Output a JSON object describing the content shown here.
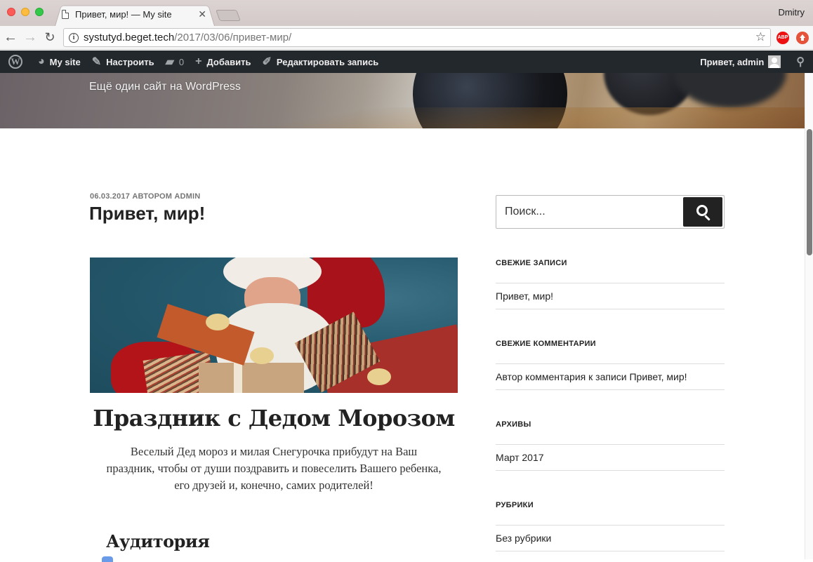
{
  "browser": {
    "tab_title": "Привет, мир! — My site",
    "profile_name": "Dmitry",
    "url_host": "systutyd.beget.tech",
    "url_path": "/2017/03/06/привет-мир/",
    "ext_abp_label": "ABP"
  },
  "admin_bar": {
    "wp_logo": "W",
    "site_name": "My site",
    "customize": "Настроить",
    "comments_count": "0",
    "add_new": "Добавить",
    "edit_post": "Редактировать запись",
    "greeting": "Привет, admin"
  },
  "header": {
    "site_description": "Ещё один сайт на WordPress"
  },
  "post": {
    "date": "06.03.2017",
    "by_label": "АВТОРОМ",
    "author": "admin",
    "title": "Привет, мир!",
    "promo_title": "Праздник с Дедом Морозом",
    "promo_text": "Веселый Дед мороз и милая Снегурочка прибудут на Ваш праздник, чтобы от души поздравить и повеселить Вашего ребенка, его друзей и, конечно, самих родителей!",
    "section_title": "Аудитория"
  },
  "sidebar": {
    "search_placeholder": "Поиск...",
    "widgets": [
      {
        "title": "СВЕЖИЕ ЗАПИСИ",
        "items": [
          "Привет, мир!"
        ]
      },
      {
        "title": "СВЕЖИЕ КОММЕНТАРИИ",
        "items": [
          "Автор комментария к записи Привет, мир!"
        ]
      },
      {
        "title": "АРХИВЫ",
        "items": [
          "Март 2017"
        ]
      },
      {
        "title": "РУБРИКИ",
        "items": [
          "Без рубрики"
        ]
      }
    ]
  }
}
